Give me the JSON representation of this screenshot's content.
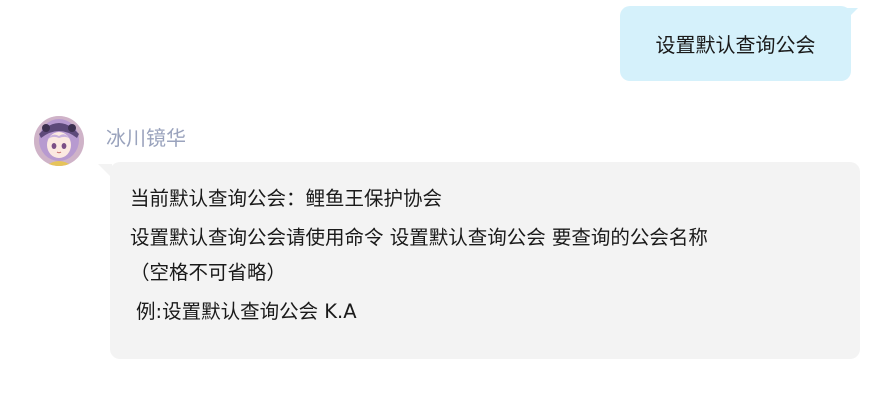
{
  "conversation": {
    "user_message": "设置默认查询公会",
    "bot": {
      "name": "冰川镜华",
      "avatar_icon": "anime-avatar-icon",
      "message_lines": [
        "当前默认查询公会：鲤鱼王保护协会",
        "设置默认查询公会请使用命令 设置默认查询公会 要查询的公会名称",
        "（空格不可省略）",
        "例:设置默认查询公会 K.A"
      ]
    }
  },
  "colors": {
    "user_bubble": "#d5f1fb",
    "bot_bubble": "#f3f3f3",
    "sender_name": "#9aa3bd",
    "text": "#1a1a1a"
  }
}
